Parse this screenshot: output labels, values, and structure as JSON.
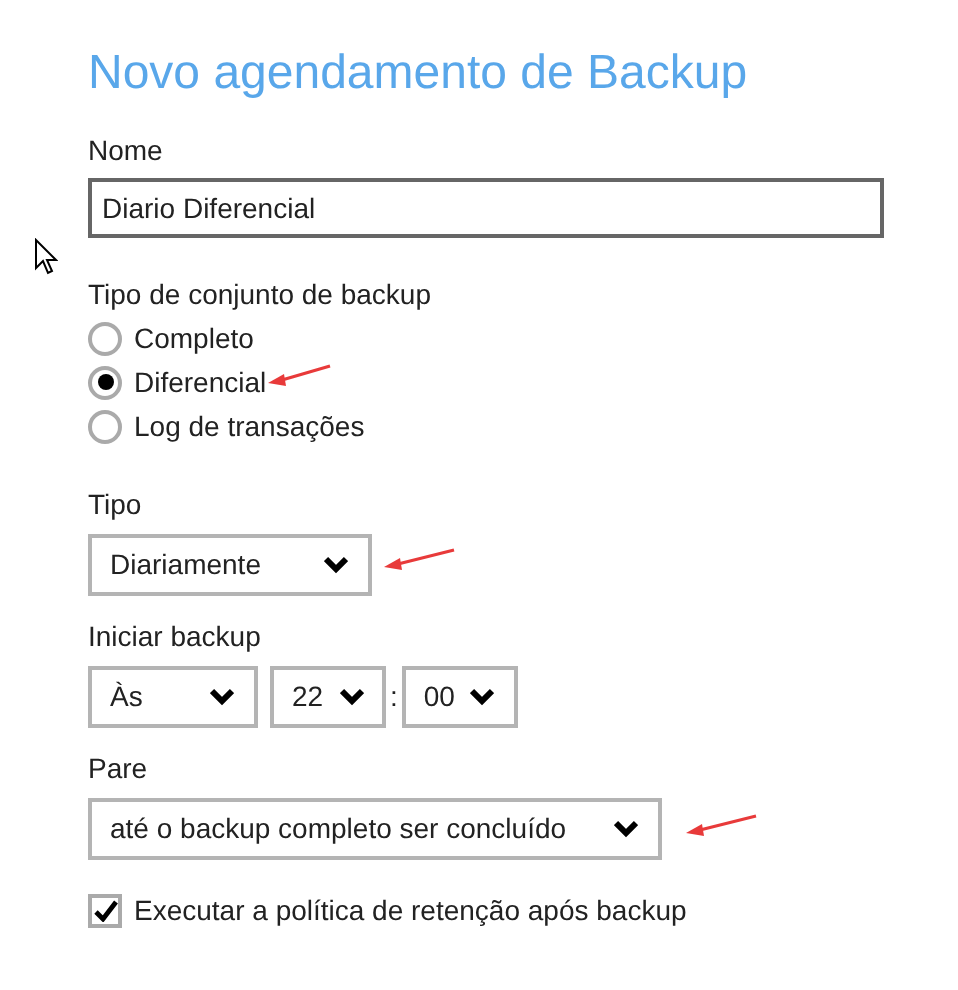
{
  "title": "Novo agendamento de Backup",
  "name_field": {
    "label": "Nome",
    "value": "Diario Diferencial"
  },
  "backup_set_type": {
    "label": "Tipo de conjunto de backup",
    "options": [
      {
        "label": "Completo",
        "selected": false,
        "annotated": false
      },
      {
        "label": "Diferencial",
        "selected": true,
        "annotated": true
      },
      {
        "label": "Log de transações",
        "selected": false,
        "annotated": false
      }
    ]
  },
  "type": {
    "label": "Tipo",
    "value": "Diariamente",
    "annotated": true
  },
  "start_backup": {
    "label": "Iniciar backup",
    "at": "Às",
    "hour": "22",
    "separator": ":",
    "minute": "00"
  },
  "stop": {
    "label": "Pare",
    "value": "até o backup completo ser concluído",
    "annotated": true
  },
  "retention": {
    "label": "Executar a política de retenção após backup",
    "checked": true
  }
}
